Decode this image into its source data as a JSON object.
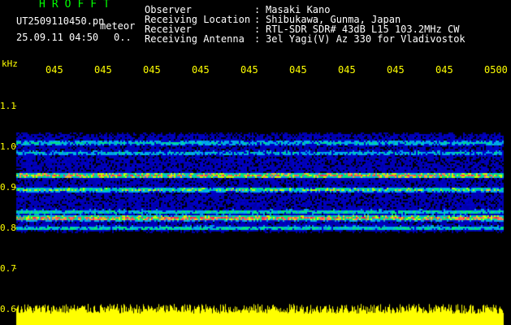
{
  "header": {
    "title": "HROFFT",
    "file_name": "UT2509110450.pn",
    "tag": "meteor",
    "datetime": "25.09.11 04:50",
    "count": "0.."
  },
  "meta": [
    {
      "label": "Observer",
      "value": "Masaki Kano"
    },
    {
      "label": "Receiving Location",
      "value": "Shibukawa, Gunma, Japan"
    },
    {
      "label": "Receiver",
      "value": "RTL-SDR SDR# 43dB L15 103.2MHz CW"
    },
    {
      "label": "Receiving Antenna",
      "value": "3el Yagi(V) Az 330 for Vladivostok"
    }
  ],
  "axis": {
    "unit": "kHz",
    "time_labels": [
      "045",
      "045",
      "045",
      "045",
      "045",
      "045",
      "045",
      "045",
      "045",
      "0500"
    ],
    "freq_labels": [
      "1.1",
      "1.0",
      "0.9",
      "0.8",
      "0.7",
      "0.6"
    ]
  },
  "colors": {
    "background": "#000000",
    "axis_text": "#ffff00",
    "title_text": "#00ff00",
    "header_text": "#ffffff",
    "amplitude_fill": "#ffff00"
  },
  "chart_data": {
    "type": "heatmap",
    "x_range_minutes": [
      0,
      10
    ],
    "y_range_khz": [
      0.6,
      1.15
    ],
    "bands_khz": [
      {
        "center": 1.01,
        "intensity": 0.55
      },
      {
        "center": 0.985,
        "intensity": 0.5
      },
      {
        "center": 0.93,
        "intensity": 0.95
      },
      {
        "center": 0.895,
        "intensity": 0.7
      },
      {
        "center": 0.84,
        "intensity": 0.6
      },
      {
        "center": 0.825,
        "intensity": 1.0
      },
      {
        "center": 0.8,
        "intensity": 0.6
      }
    ],
    "noise_floor_khz": [
      0.78,
      1.045
    ]
  }
}
